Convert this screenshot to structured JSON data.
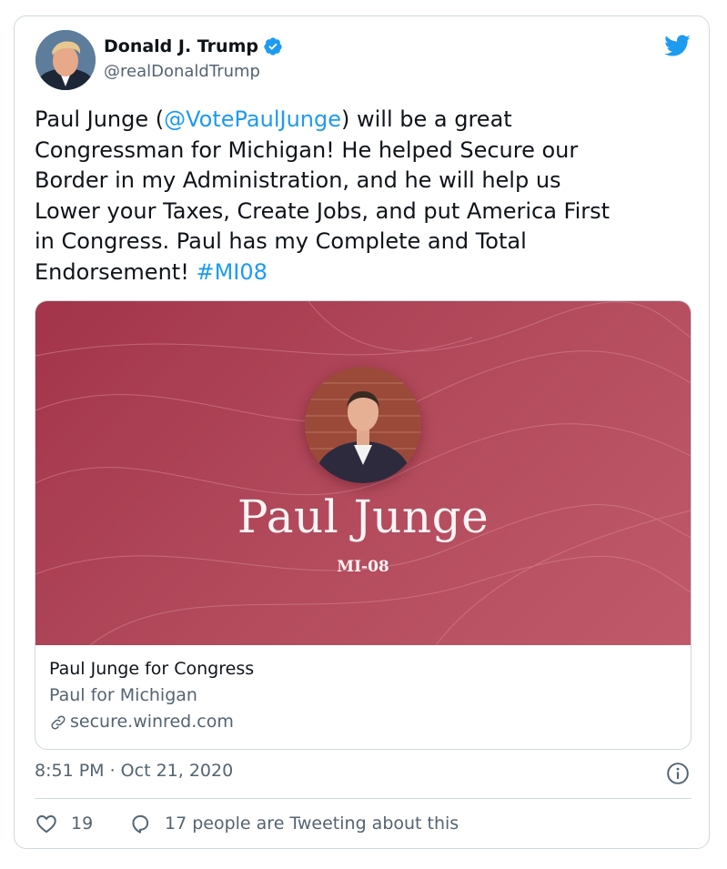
{
  "author": {
    "name": "Donald J. Trump",
    "handle": "@realDonaldTrump"
  },
  "tweet": {
    "seg1": "Paul Junge (",
    "mention": "@VotePaulJunge",
    "seg2": ") will be a great\nCongressman for Michigan! He helped Secure our\nBorder in my Administration, and he will help us\nLower your Taxes, Create Jobs, and put America First\nin Congress. Paul has my Complete and Total\nEndorsement! ",
    "hashtag": "#MI08"
  },
  "card": {
    "banner_name": "Paul Junge",
    "banner_district": "MI-08",
    "title": "Paul Junge for Congress",
    "description": "Paul for Michigan",
    "domain": "secure.winred.com"
  },
  "meta": {
    "timestamp": "8:51 PM · Oct 21, 2020"
  },
  "engagement": {
    "likes": "19",
    "replies_text": "17 people are Tweeting about this"
  },
  "colors": {
    "link": "#1d9bf0",
    "banner": "#b24a5c",
    "secondary_text": "#536471"
  },
  "icons": [
    "verified-badge-icon",
    "twitter-bird-icon",
    "link-icon",
    "info-icon",
    "heart-icon",
    "reply-bubble-icon"
  ]
}
